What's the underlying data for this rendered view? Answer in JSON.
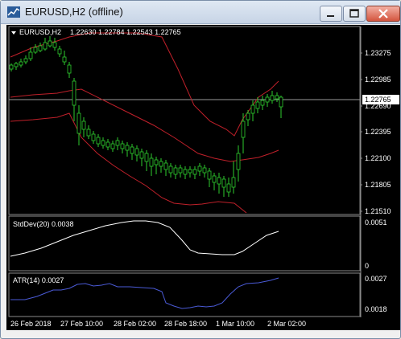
{
  "window": {
    "title": "EURUSD,H2 (offline)",
    "buttons": [
      "minimize",
      "maximize",
      "close"
    ]
  },
  "main_panel": {
    "header_prefix": "EURUSD,H2",
    "ohlc": "1.22630 1.22784 1.22543 1.22765",
    "price_ticks": [
      "1.23275",
      "1.22985",
      "1.22690",
      "1.22395",
      "1.22100",
      "1.21805",
      "1.21510"
    ],
    "current_price": "1.22765"
  },
  "stddev_panel": {
    "label": "StdDev(20) 0.0038",
    "ticks": [
      "0.0051",
      "0"
    ]
  },
  "atr_panel": {
    "label": "ATR(14) 0.0027",
    "ticks": [
      "0.0027",
      "0.0018"
    ]
  },
  "time_axis": [
    "26 Feb 2018",
    "27 Feb 10:00",
    "28 Feb 02:00",
    "28 Feb 18:00",
    "1 Mar 10:00",
    "2 Mar 02:00"
  ],
  "colors": {
    "candle": "#2ecc2e",
    "band": "#c0202a",
    "stddev": "#ffffff",
    "atr": "#4a5ad6",
    "background": "#000000"
  }
}
